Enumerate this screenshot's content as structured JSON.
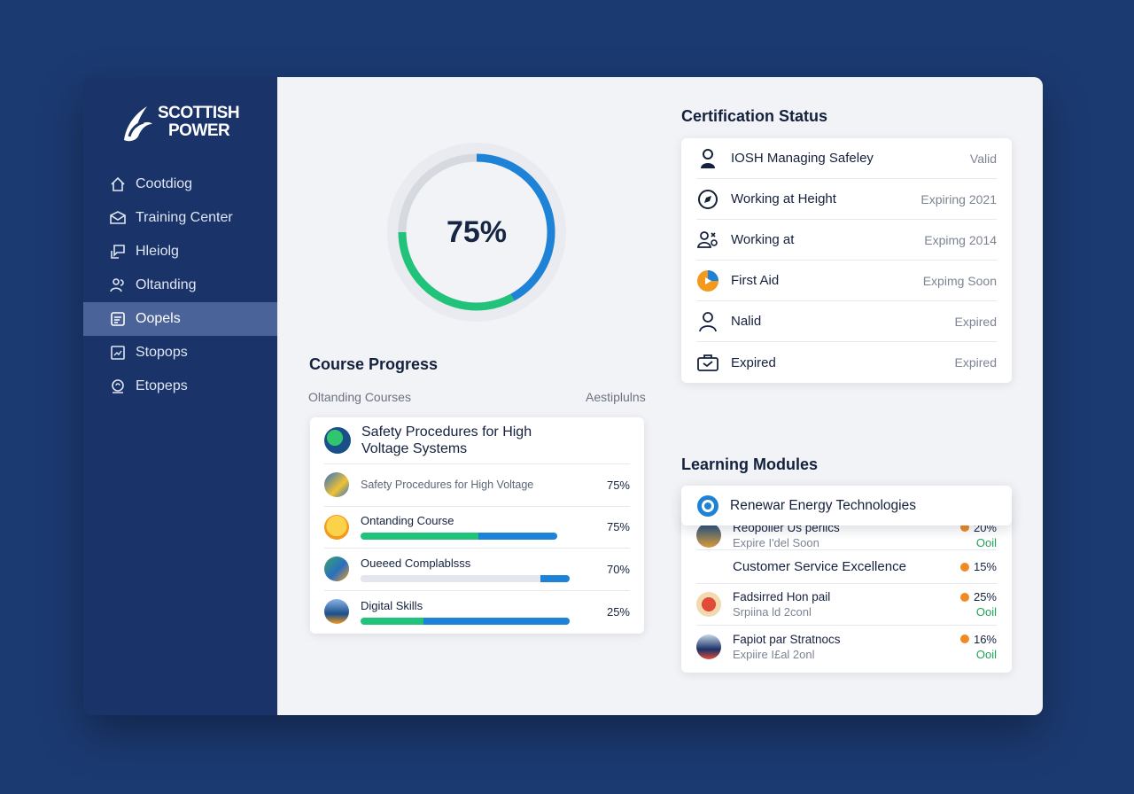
{
  "brand": {
    "line1": "SCOTTISH",
    "line2": "POWER"
  },
  "sidebar": {
    "items": [
      {
        "label": "Cootdiog",
        "icon": "home-icon",
        "active": false
      },
      {
        "label": "Training Center",
        "icon": "envelope-icon",
        "active": false
      },
      {
        "label": "Hleiolg",
        "icon": "chat-icon",
        "active": false
      },
      {
        "label": "Oltanding",
        "icon": "people-icon",
        "active": false
      },
      {
        "label": "Oopels",
        "icon": "report-icon",
        "active": true
      },
      {
        "label": "Stopops",
        "icon": "chart-icon",
        "active": false
      },
      {
        "label": "Etopeps",
        "icon": "support-icon",
        "active": false
      }
    ]
  },
  "progress": {
    "label": "75%",
    "value": 0.75
  },
  "course_progress": {
    "title": "Course Progress",
    "left_heading": "Oltanding Courses",
    "right_heading": "Aestiplulns",
    "featured": "Safety Procedures for High Voltage Systems",
    "rows": [
      {
        "name": "Safety Procedures for High Voltage",
        "pct": "75%",
        "bar": null
      },
      {
        "name": "Ontanding Course",
        "pct": "75%",
        "bar": {
          "green": 0.6,
          "blue": 0.4
        }
      },
      {
        "name": "Oueeed Complablsss",
        "pct": "70%",
        "bar": {
          "green": 0.86,
          "blue": 0.14
        }
      },
      {
        "name": "Digital Skills",
        "pct": "25%",
        "bar": {
          "green": 0.3,
          "blue": 0.7
        }
      }
    ]
  },
  "certification": {
    "title": "Certification Status",
    "rows": [
      {
        "name": "IOSH Managing Safeley",
        "status": "Valid",
        "icon": "user-icon"
      },
      {
        "name": "Working at Height",
        "status": "Expiring 2021",
        "icon": "compass-icon"
      },
      {
        "name": "Working at",
        "status": "Expimg 2014",
        "icon": "group-icon"
      },
      {
        "name": "First Aid",
        "status": "Expimg Soon",
        "icon": "first-aid-icon"
      },
      {
        "name": "Nalid",
        "status": "Expired",
        "icon": "person-icon"
      },
      {
        "name": "Expired",
        "status": "Expired",
        "icon": "briefcase-icon"
      }
    ]
  },
  "modules": {
    "title": "Learning Modules",
    "featured": "Renewar Energy Technologies",
    "rows": [
      {
        "t1": "Reopolier Us perlics",
        "t2": "Expire I'del Soon",
        "r1": "20%",
        "r2": "Ooil"
      },
      {
        "t1": "Customer Service Excellence",
        "t2": "",
        "r1": "15%",
        "r2": ""
      },
      {
        "t1": "Fadsirred Hon pail",
        "t2": "Srpiina ld 2conl",
        "r1": "25%",
        "r2": "Ooil"
      },
      {
        "t1": "Fapiot par Stratnocs",
        "t2": "Expiire I£al 2onl",
        "r1": "16%",
        "r2": "Ooil"
      }
    ]
  },
  "colors": {
    "navy": "#1c3a72",
    "sidebar": "#1a3368",
    "active": "#4a6398",
    "green": "#21c37a",
    "blue": "#1e83d6",
    "orange": "#f08a24"
  }
}
